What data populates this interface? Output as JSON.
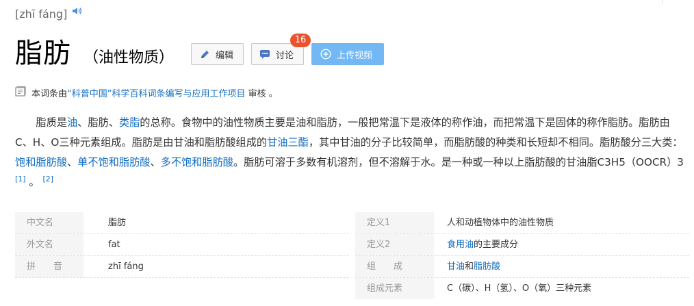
{
  "pinyin": "[zhī fáng]",
  "title": "脂肪",
  "subtitle": "（油性物质）",
  "buttons": {
    "edit": "编辑",
    "discuss": "讨论",
    "discuss_count": "16",
    "upload": "上传视频"
  },
  "notice": {
    "prefix": "本词条由",
    "link": "“科普中国”科学百科词条编写与应用工作项目",
    "suffix": " 审核 。"
  },
  "summary": [
    {
      "t": "脂质是"
    },
    {
      "t": "油",
      "link": true
    },
    {
      "t": "、脂肪、"
    },
    {
      "t": "类脂",
      "link": true
    },
    {
      "t": "的总称。食物中的油性物质主要是油和脂肪，一般把常温下是液体的称作油，而把常温下是固体的称作脂肪。脂肪由C、H、O三种元素组成。脂肪是由甘油和脂肪酸组成的"
    },
    {
      "t": "甘油三酯",
      "link": true
    },
    {
      "t": "，其中甘油的分子比较简单，而脂肪酸的种类和长短却不相同。脂肪酸分三大类："
    },
    {
      "t": "饱和脂肪酸",
      "link": true
    },
    {
      "t": "、"
    },
    {
      "t": "单不饱和脂肪酸",
      "link": true
    },
    {
      "t": "、"
    },
    {
      "t": "多不饱和脂肪酸",
      "link": true
    },
    {
      "t": "。脂肪可溶于多数有机溶剂，但不溶解于水。是一种或一种以上脂肪酸的甘油脂C3H5（OOCR）3 "
    },
    {
      "t": "[1]",
      "sup": true
    },
    {
      "t": " 。 "
    },
    {
      "t": "[2]",
      "sup": true
    }
  ],
  "infobox": {
    "left": [
      {
        "name": "中文名",
        "value": [
          {
            "t": "脂肪"
          }
        ]
      },
      {
        "name": "外文名",
        "value": [
          {
            "t": "fat"
          }
        ]
      },
      {
        "name": "拼　　音",
        "value": [
          {
            "t": "zhī fáng"
          }
        ]
      }
    ],
    "right": [
      {
        "name": "定义1",
        "value": [
          {
            "t": "人和动植物体中的油性物质"
          }
        ]
      },
      {
        "name": "定义2",
        "value": [
          {
            "t": "食用油",
            "link": true
          },
          {
            "t": "的主要成分"
          }
        ]
      },
      {
        "name": "组　　成",
        "value": [
          {
            "t": "甘油",
            "link": true
          },
          {
            "t": "和"
          },
          {
            "t": "脂肪酸",
            "link": true
          }
        ]
      },
      {
        "name": "组成元素",
        "value": [
          {
            "t": "C（碳）、H（氢）、O（氧）三种元素"
          }
        ]
      }
    ]
  },
  "colors": {
    "link": "#136ec2",
    "badge": "#e8532e",
    "upload_button": "#73b7f5",
    "infobox_name_bg": "#f5f5f5"
  },
  "icons": [
    "speaker-icon",
    "pencil-icon",
    "comment-icon",
    "plus-circle-icon",
    "document-icon"
  ]
}
